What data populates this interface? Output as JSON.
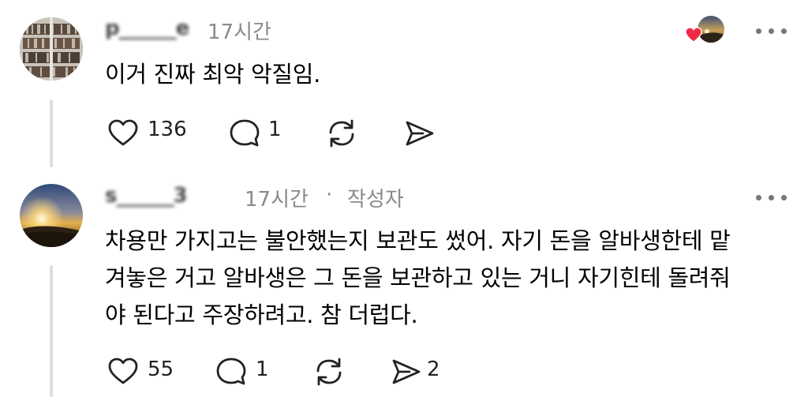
{
  "comments": [
    {
      "username": "p______e",
      "time": "17시간",
      "text": "이거 진짜 최악 악질임.",
      "likes": "136",
      "replies": "1",
      "shares": ""
    },
    {
      "username": "s______3",
      "time": "17시간",
      "author_separator": "·",
      "author_badge": "작성자",
      "text_lines": [
        "차용만 가지고는 불안했는지 보관도 썼어. 자기 돈을 알바생한테 맡",
        "겨놓은 거고 알바생은 그 돈을 보관하고 있는 거니 자기힌테 돌려줘",
        "야 된다고 주장하려고. 참 더럽다."
      ],
      "likes": "55",
      "replies": "1",
      "shares": "2"
    }
  ],
  "colors": {
    "heart": "#ee2a45",
    "meta": "#8a8a8a",
    "thread_line": "#dedede"
  },
  "icons": [
    "heart-icon",
    "comment-icon",
    "repost-icon",
    "share-icon",
    "more-icon"
  ]
}
